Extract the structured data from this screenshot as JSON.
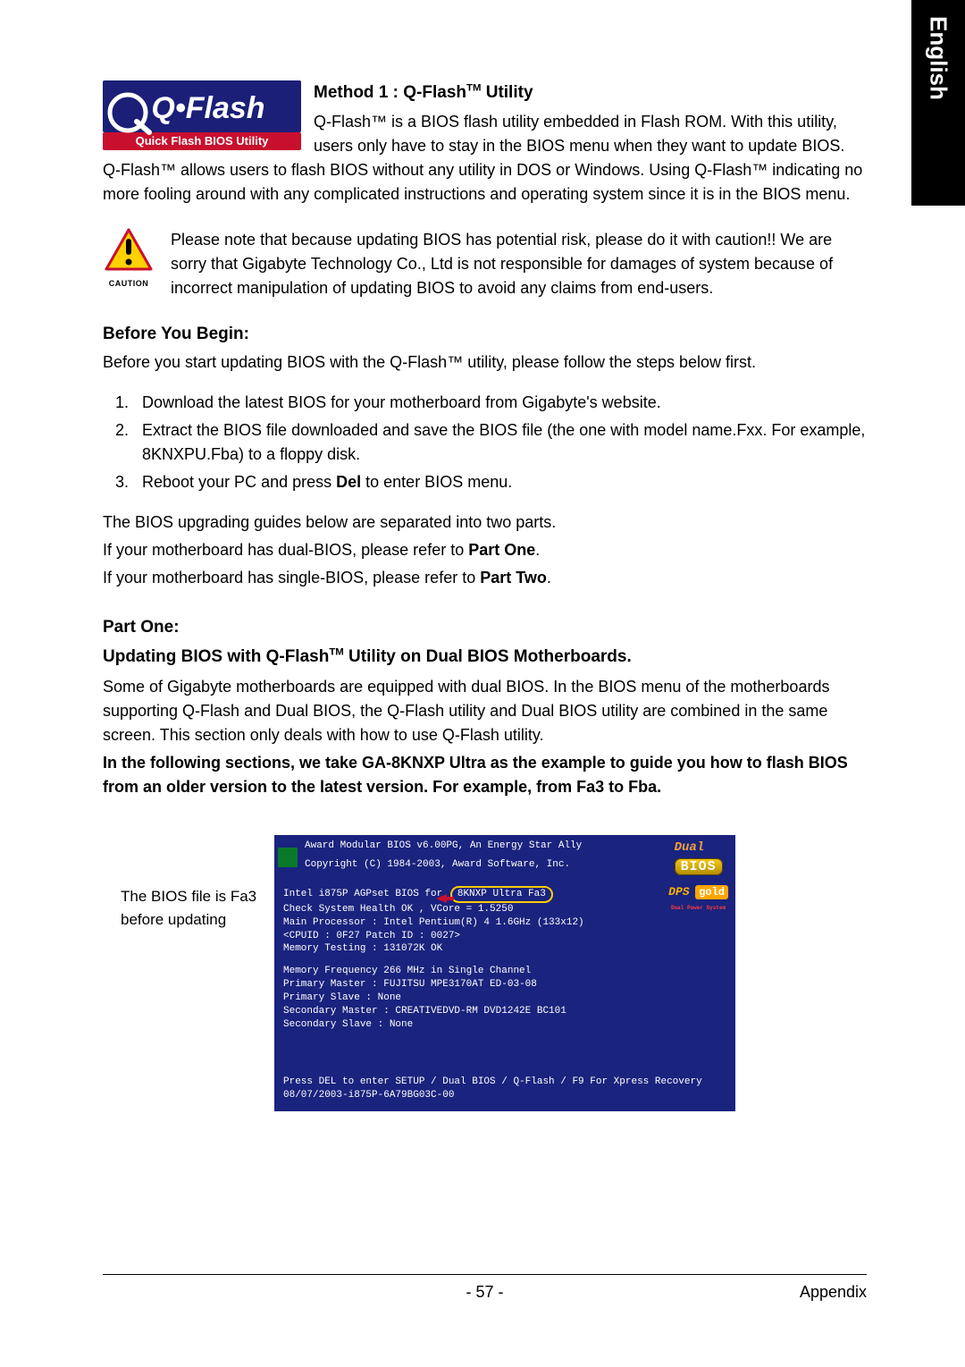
{
  "sideTab": "English",
  "logo": {
    "main": "Q•Flash",
    "sub": "Quick Flash BIOS Utility"
  },
  "methodTitle_pre": "Method 1 : Q-Flash",
  "methodTitle_post": " Utility",
  "intro": "Q-Flash™ is a BIOS flash utility embedded in Flash ROM. With this utility, users only have to stay in the BIOS menu when they want to update BIOS. Q-Flash™ allows users to flash BIOS without any utility in DOS or Windows. Using Q-Flash™ indicating no more fooling around with any complicated instructions and operating system since it is in the BIOS menu.",
  "cautionLabel": "CAUTION",
  "caution": "Please note that because updating BIOS has potential risk, please do it with caution!! We are sorry that Gigabyte Technology Co., Ltd is not responsible for damages of system because of incorrect manipulation of updating BIOS to avoid any claims from end-users.",
  "beforeTitle": "Before You Begin:",
  "beforeText": "Before you start updating BIOS with the Q-Flash™ utility, please follow the steps below first.",
  "steps": [
    "Download the latest BIOS for your motherboard from Gigabyte's website.",
    "Extract the BIOS file downloaded and save the BIOS file (the one with model name.Fxx. For example, 8KNXPU.Fba) to a floppy disk.",
    "Reboot your PC and press Del to enter BIOS menu."
  ],
  "guides_intro": "The BIOS upgrading guides below are separated into two parts.",
  "guides_dual_pre": "If your motherboard has dual-BIOS, please refer to ",
  "guides_dual_bold": "Part One",
  "guides_single_pre": "If your motherboard has single-BIOS, please refer to ",
  "guides_single_bold": "Part Two",
  "partOneTitle": "Part One:",
  "partOneSub_pre": "Updating BIOS with Q-Flash",
  "partOneSub_post": " Utility on Dual BIOS Motherboards.",
  "partOneBody": "Some of Gigabyte motherboards are equipped with dual BIOS. In the BIOS menu of the motherboards supporting Q-Flash and Dual BIOS, the Q-Flash utility and Dual BIOS utility are combined in the same screen. This section only deals with how to use Q-Flash utility.",
  "partOneBold": "In the following sections, we take GA-8KNXP Ultra as the example to guide you how to flash BIOS from an older version to the latest version. For example, from Fa3 to Fba.",
  "biosNote": "The BIOS file is Fa3 before updating",
  "bios": {
    "hdr1": "Award Modular BIOS v6.00PG, An Energy Star Ally",
    "hdr2": "Copyright  (C) 1984-2003, Award Software, Inc.",
    "l1a": "Intel i875P AGPset BIOS for",
    "l1b": "8KNXP Ultra Fa3",
    "l2": "Check System Health OK , VCore = 1.5250",
    "l3": "Main Processor : Intel Pentium(R) 4  1.6GHz (133x12)",
    "l4": "<CPUID : 0F27 Patch ID  : 0027>",
    "l5": "Memory Testing  : 131072K OK",
    "l6": "Memory Frequency 266 MHz in Single Channel",
    "l7": "Primary Master : FUJITSU MPE3170AT ED-03-08",
    "l8": "Primary Slave : None",
    "l9": "Secondary Master : CREATIVEDVD-RM DVD1242E BC101",
    "l10": "Secondary Slave : None",
    "foot1": "Press DEL to enter SETUP / Dual BIOS / Q-Flash / F9 For Xpress Recovery",
    "foot2": "08/07/2003-i875P-6A79BG03C-00",
    "badge_dual": "Dual",
    "badge_bios": "BIOS",
    "badge_dps": "DPS",
    "badge_gold": "gold",
    "badge_dpss": "Dual Power System"
  },
  "footer": {
    "page": "- 57 -",
    "section": "Appendix"
  }
}
